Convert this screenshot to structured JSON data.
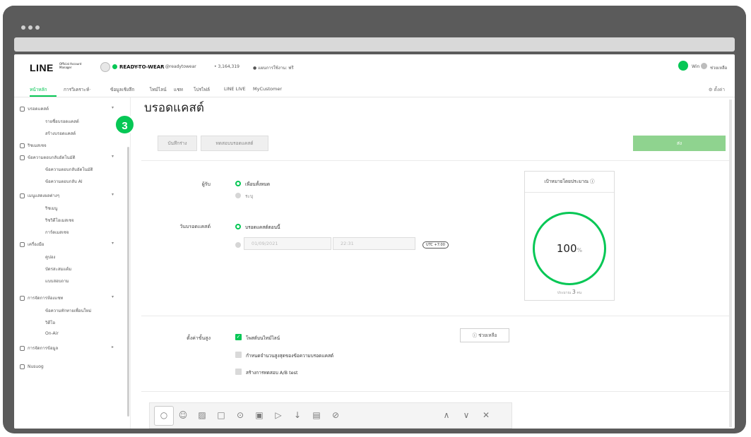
{
  "header": {
    "logo": "LINE",
    "logo_sub": "Official Account Manager",
    "account_name": "READY-TO-WEAR",
    "account_id": "▾ @readytowear",
    "friends": "• 3,164,319",
    "plan": "● แผนการใช้งาน: ฟรี",
    "user": "Win",
    "help": "ช่วยเหลือ"
  },
  "nav": {
    "items": [
      "หน้าหลัก",
      "การวิเคราะห์·",
      "ข้อมูลเชิงลึก",
      "ไทม์ไลน์",
      "แชท",
      "โปรไฟล์",
      "LINE LIVE",
      "MyCustomer"
    ],
    "settings": "⚙ ตั้งค่า"
  },
  "sidebar": {
    "broadcast": "บรอดแคสต์",
    "broadcast_list": "รายชื่อบรอดแคสต์",
    "broadcast_create": "สร้างบรอดแคสต์",
    "rich_message": "ริชเมสเซจ",
    "auto_reply": "ข้อความตอบกลับอัตโนมัติ",
    "auto_reply_msg": "ข้อความตอบกลับอัตโนมัติ",
    "auto_reply_ai": "ข้อความตอบกลับ AI",
    "menu_display": "เมนูแสดงผลต่างๆ",
    "rich_menu": "ริชเมนู",
    "rich_video": "ริชวิดีโอเมสเซจ",
    "card_message": "การ์ดเมสเซจ",
    "tools": "เครื่องมือ",
    "coupon": "คูปอง",
    "reward_card": "บัตรสะสมแต้ม",
    "survey": "แบบสอบถาม",
    "chat_settings": "การจัดการห้องแชท",
    "greeting": "ข้อความทักทายเพื่อนใหม่",
    "video": "วิดีโอ",
    "onair": "On-Air",
    "data_mgmt": "การจัดการข้อมูล",
    "more": "Nusuog",
    "step_badge": "3"
  },
  "main": {
    "title": "บรอดแคสต์",
    "save_draft": "บันทึกร่าง",
    "test_broadcast": "ทดสอบบรอดแคสต์",
    "send": "ส่ง",
    "recipients_label": "ผู้รับ",
    "recipients_all": "เพื่อนทั้งหมด",
    "recipients_specify": "ระบุ",
    "date_label": "วันบรอดแคสต์",
    "date_now": "บรอดแคสต์ตอนนี้",
    "date_value": "01/09/2021",
    "time_value": "22:31",
    "timezone": "UTC +7:00",
    "estimate_title": "เป้าหมายโดยประมาณ ⓘ",
    "estimate_pct": "100",
    "estimate_pct_unit": "%",
    "estimate_fraction": 1.0,
    "estimate_note_pre": "ประมาณ",
    "estimate_note_num": "3",
    "estimate_note_post": "คน",
    "advanced_label": "ตั้งค่าขั้นสูง",
    "adv_timeline": "โพสต์บนไทม์ไลน์",
    "adv_limit": "กำหนดจำนวนสูงสุดของข้อความบรอดแคสต์",
    "adv_ab": "สร้างการทดสอบ A/B test",
    "help_btn": "ⓘ ช่วยเหลือ"
  },
  "toolbar": {
    "icons": [
      "○",
      "☺",
      "▨",
      "□",
      "⊙",
      "▣",
      "▷",
      "↓",
      "▤",
      "⊘"
    ],
    "up": "∧",
    "down": "∨",
    "close": "✕"
  },
  "colors": {
    "accent": "#06c755",
    "send_disabled": "#8fd38f"
  }
}
